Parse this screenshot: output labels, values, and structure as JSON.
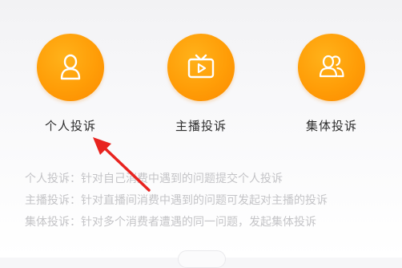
{
  "options": [
    {
      "label": "个人投诉",
      "icon": "person-icon"
    },
    {
      "label": "主播投诉",
      "icon": "tv-play-icon"
    },
    {
      "label": "集体投诉",
      "icon": "group-icon"
    }
  ],
  "descriptions": [
    {
      "title": "个人投诉",
      "separator": "：",
      "text": "针对自己消费中遇到的问题提交个人投诉"
    },
    {
      "title": "主播投诉",
      "separator": "：",
      "text": "针对直播间消费中遇到的问题可发起对主播的投诉"
    },
    {
      "title": "集体投诉",
      "separator": "：",
      "text": "针对多个消费者遭遇的同一问题，发起集体投诉"
    }
  ],
  "colors": {
    "accent": "#ff9d07",
    "arrow": "#e8231f",
    "label_text": "#2d2d2d",
    "desc_text": "#c4c4c7"
  }
}
